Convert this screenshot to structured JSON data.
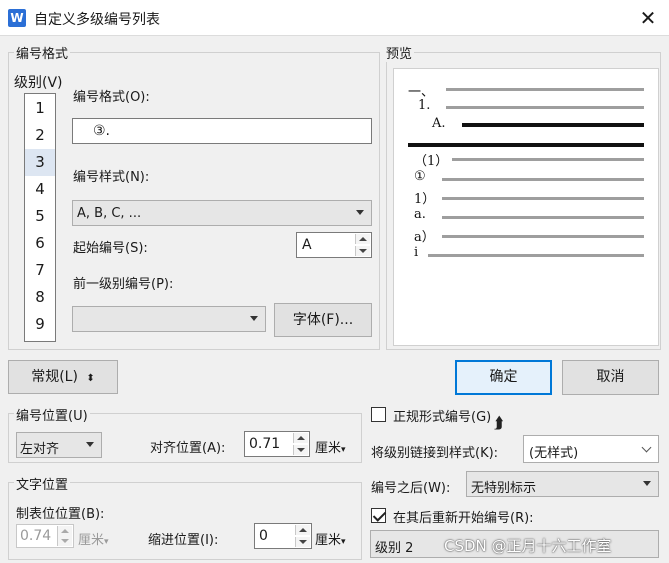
{
  "window": {
    "title": "自定义多级编号列表",
    "icon": "W"
  },
  "number_format": {
    "group_title": "编号格式",
    "level_label": "级别(V)",
    "levels": [
      "1",
      "2",
      "3",
      "4",
      "5",
      "6",
      "7",
      "8",
      "9"
    ],
    "selected_level": "3",
    "format_label": "编号格式(O):",
    "format_value": "③.",
    "style_label": "编号样式(N):",
    "style_value": "A, B, C, ...",
    "start_label": "起始编号(S):",
    "start_value": "A",
    "prev_level_label": "前一级别编号(P):",
    "prev_level_value": "",
    "font_button": "字体(F)..."
  },
  "preview": {
    "title": "预览",
    "labels": [
      "一、",
      "1.",
      "A.",
      "（1）",
      "①",
      "1）",
      "a.",
      "a）",
      "i"
    ]
  },
  "buttons": {
    "general": "常规(L)",
    "ok": "确定",
    "cancel": "取消"
  },
  "number_position": {
    "title": "编号位置(U)",
    "align_value": "左对齐",
    "align_at_label": "对齐位置(A):",
    "align_at_value": "0.71",
    "unit": "厘米"
  },
  "text_position": {
    "title": "文字位置",
    "tab_label": "制表位位置(B):",
    "tab_value": "0.74",
    "tab_unit": "厘米",
    "indent_label": "缩进位置(I):",
    "indent_value": "0",
    "indent_unit": "厘米"
  },
  "right_options": {
    "legal_label": "正规形式编号(G)",
    "legal_checked": false,
    "link_label": "将级别链接到样式(K):",
    "link_value": "(无样式)",
    "after_label": "编号之后(W):",
    "after_value": "无特别标示",
    "restart_label": "在其后重新开始编号(R):",
    "restart_checked": true,
    "restart_value": "级别 2"
  },
  "watermark": "CSDN @正月十六工作室"
}
